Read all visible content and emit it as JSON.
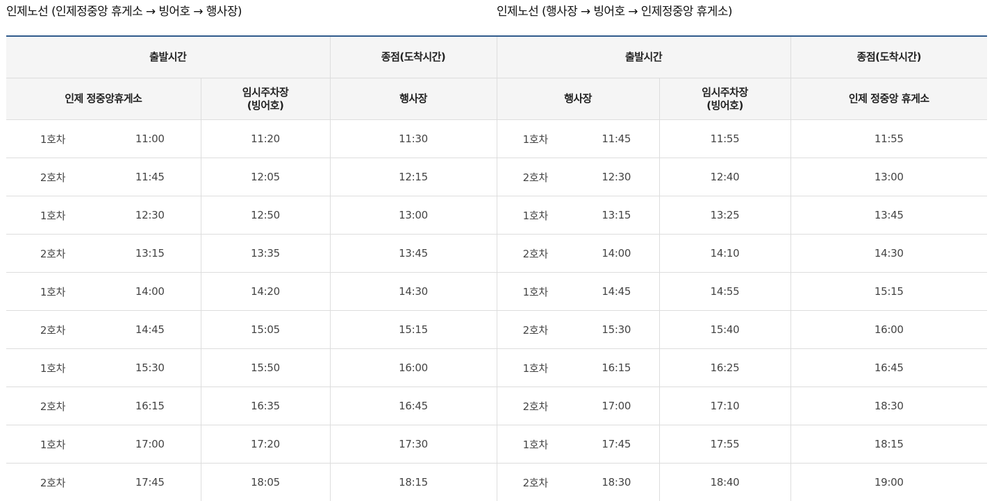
{
  "titles": {
    "left": "인제노선 (인제정중앙 휴게소 → 빙어호 → 행사장)",
    "right": "인제노선 (행사장 → 빙어호 → 인제정중앙 휴게소)"
  },
  "headers": {
    "left": {
      "departure": "출발시간",
      "terminal": "종점(도착시간)",
      "stop1": "인제 정중앙휴게소",
      "stop2_line1": "임시주차장",
      "stop2_line2": "(빙어호)",
      "stop3": "행사장"
    },
    "right": {
      "departure": "출발시간",
      "terminal": "종점(도착시간)",
      "stop1": "행사장",
      "stop2_line1": "임시주차장",
      "stop2_line2": "(빙어호)",
      "stop3": "인제 정중앙 휴게소"
    }
  },
  "rows": [
    {
      "left": {
        "bus": "1호차",
        "t1": "11:00",
        "t2": "11:20",
        "t3": "11:30"
      },
      "right": {
        "bus": "1호차",
        "t1": "11:45",
        "t2": "11:55",
        "t3": "11:55"
      }
    },
    {
      "left": {
        "bus": "2호차",
        "t1": "11:45",
        "t2": "12:05",
        "t3": "12:15"
      },
      "right": {
        "bus": "2호차",
        "t1": "12:30",
        "t2": "12:40",
        "t3": "13:00"
      }
    },
    {
      "left": {
        "bus": "1호차",
        "t1": "12:30",
        "t2": "12:50",
        "t3": "13:00"
      },
      "right": {
        "bus": "1호차",
        "t1": "13:15",
        "t2": "13:25",
        "t3": "13:45"
      }
    },
    {
      "left": {
        "bus": "2호차",
        "t1": "13:15",
        "t2": "13:35",
        "t3": "13:45"
      },
      "right": {
        "bus": "2호차",
        "t1": "14:00",
        "t2": "14:10",
        "t3": "14:30"
      }
    },
    {
      "left": {
        "bus": "1호차",
        "t1": "14:00",
        "t2": "14:20",
        "t3": "14:30"
      },
      "right": {
        "bus": "1호차",
        "t1": "14:45",
        "t2": "14:55",
        "t3": "15:15"
      }
    },
    {
      "left": {
        "bus": "2호차",
        "t1": "14:45",
        "t2": "15:05",
        "t3": "15:15"
      },
      "right": {
        "bus": "2호차",
        "t1": "15:30",
        "t2": "15:40",
        "t3": "16:00"
      }
    },
    {
      "left": {
        "bus": "1호차",
        "t1": "15:30",
        "t2": "15:50",
        "t3": "16:00"
      },
      "right": {
        "bus": "1호차",
        "t1": "16:15",
        "t2": "16:25",
        "t3": "16:45"
      }
    },
    {
      "left": {
        "bus": "2호차",
        "t1": "16:15",
        "t2": "16:35",
        "t3": "16:45"
      },
      "right": {
        "bus": "2호차",
        "t1": "17:00",
        "t2": "17:10",
        "t3": "18:30"
      }
    },
    {
      "left": {
        "bus": "1호차",
        "t1": "17:00",
        "t2": "17:20",
        "t3": "17:30"
      },
      "right": {
        "bus": "1호차",
        "t1": "17:45",
        "t2": "17:55",
        "t3": "18:15"
      }
    },
    {
      "left": {
        "bus": "2호차",
        "t1": "17:45",
        "t2": "18:05",
        "t3": "18:15"
      },
      "right": {
        "bus": "2호차",
        "t1": "18:30",
        "t2": "18:40",
        "t3": "19:00"
      }
    }
  ]
}
